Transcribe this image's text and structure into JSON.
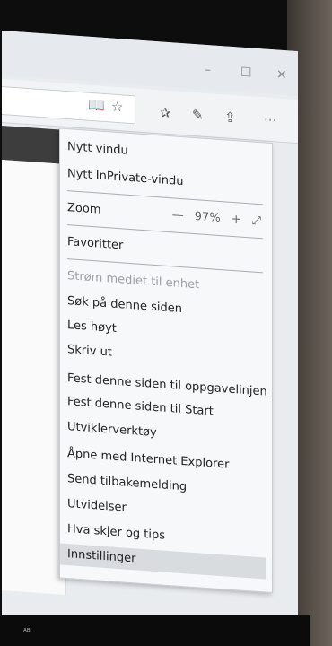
{
  "window": {
    "minimize": "–",
    "maximize": "☐",
    "close": "✕"
  },
  "toolbar": {
    "reading_view_icon": "📖",
    "favorite_star": "☆",
    "favorites_hub": "✰",
    "notes_pen": "✎",
    "share": "⇪",
    "more": "···"
  },
  "menu": {
    "items": [
      {
        "label": "Nytt vindu"
      },
      {
        "label": "Nytt InPrivate-vindu"
      }
    ],
    "zoom": {
      "label": "Zoom",
      "minus": "—",
      "value": "97%",
      "plus": "+",
      "fullscreen": "⤢"
    },
    "favorites": "Favoritter",
    "cast": "Strøm mediet til enhet",
    "list": [
      "Søk på denne siden",
      "Les høyt",
      "Skriv ut",
      "Fest denne siden til oppgavelinjen",
      "Fest denne siden til Start",
      "Utviklerverktøy",
      "Åpne med Internet Explorer",
      "Send tilbakemelding",
      "Utvidelser",
      "Hva skjer og tips",
      "Innstillinger"
    ]
  },
  "taskbar_label": "ᴬᴮ"
}
